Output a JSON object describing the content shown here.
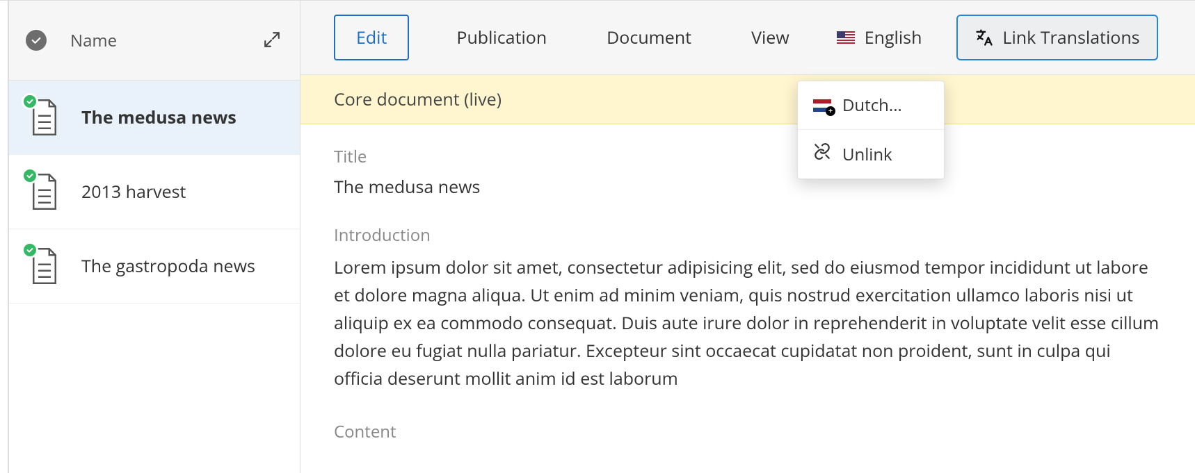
{
  "sidebar": {
    "name_header": "Name",
    "items": [
      {
        "label": "The medusa news",
        "selected": true
      },
      {
        "label": "2013 harvest",
        "selected": false
      },
      {
        "label": "The gastropoda news",
        "selected": false
      }
    ]
  },
  "toolbar": {
    "edit": "Edit",
    "publication": "Publication",
    "document": "Document",
    "view": "View",
    "language_label": "English",
    "link_translations": "Link Translations"
  },
  "banner": {
    "text": "Core document (live)"
  },
  "fields": {
    "title_label": "Title",
    "title_value": "The medusa news",
    "introduction_label": "Introduction",
    "introduction_value": "Lorem ipsum dolor sit amet, consectetur adipisicing elit, sed do eiusmod tempor incididunt ut labore et dolore magna aliqua. Ut enim ad minim veniam, quis nostrud exercitation ullamco laboris nisi ut aliquip ex ea commodo consequat. Duis aute irure dolor in reprehenderit in voluptate velit esse cillum dolore eu fugiat nulla pariatur. Excepteur sint occaecat cupidatat non proident, sunt in culpa qui officia deserunt mollit anim id est laborum",
    "content_label": "Content"
  },
  "dropdown": {
    "dutch": "Dutch...",
    "unlink": "Unlink"
  }
}
